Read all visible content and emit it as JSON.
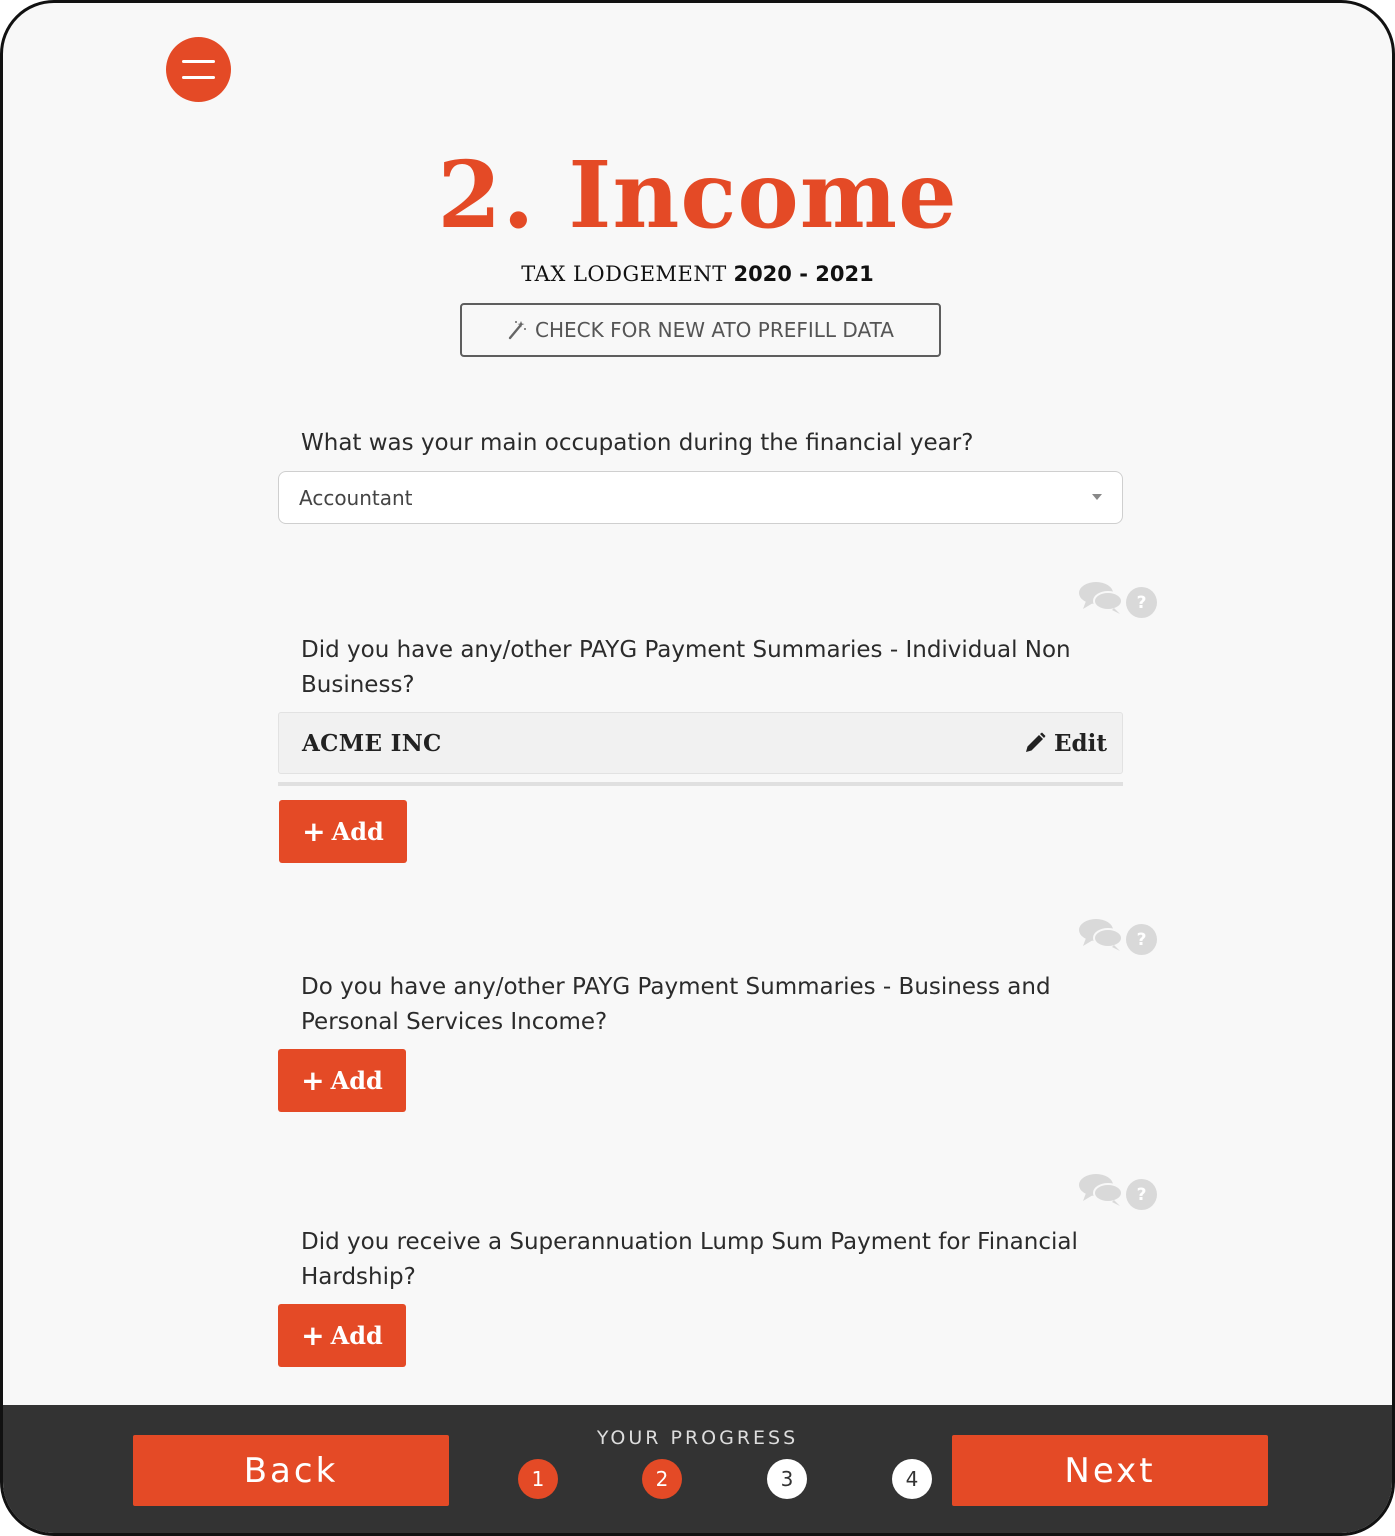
{
  "header": {
    "title": "2. Income",
    "subtitle_label": "TAX LODGEMENT",
    "subtitle_year": "2020 - 2021",
    "prefill_button_label": "CHECK FOR NEW ATO PREFILL DATA"
  },
  "occupation": {
    "question": "What was your main occupation during the financial year?",
    "selected_value": "Accountant"
  },
  "sections": [
    {
      "question": "Did you have any/other PAYG Payment Summaries - Individual Non Business?",
      "entries": [
        {
          "name": "ACME INC",
          "edit_label": "Edit"
        }
      ],
      "add_label": "Add"
    },
    {
      "question": "Do you have any/other PAYG Payment Summaries - Business and Personal Services Income?",
      "entries": [],
      "add_label": "Add"
    },
    {
      "question": "Did you receive a Superannuation Lump Sum Payment for Financial Hardship?",
      "entries": [],
      "add_label": "Add"
    }
  ],
  "help_icon_glyph": "?",
  "footer": {
    "back_label": "Back",
    "next_label": "Next",
    "progress_label": "YOUR PROGRESS",
    "steps": [
      {
        "number": "1",
        "state": "done"
      },
      {
        "number": "2",
        "state": "current"
      },
      {
        "number": "3",
        "state": "todo"
      },
      {
        "number": "4",
        "state": "todo"
      }
    ]
  },
  "colors": {
    "accent": "#e44a26",
    "footer_bg": "#333333",
    "page_bg": "#f8f8f8"
  },
  "icons": {
    "menu": "hamburger-menu-icon",
    "prefill": "magic-wand-icon",
    "comment": "chat-bubbles-icon",
    "help": "question-mark-icon",
    "edit": "pencil-icon",
    "add": "plus-icon"
  }
}
